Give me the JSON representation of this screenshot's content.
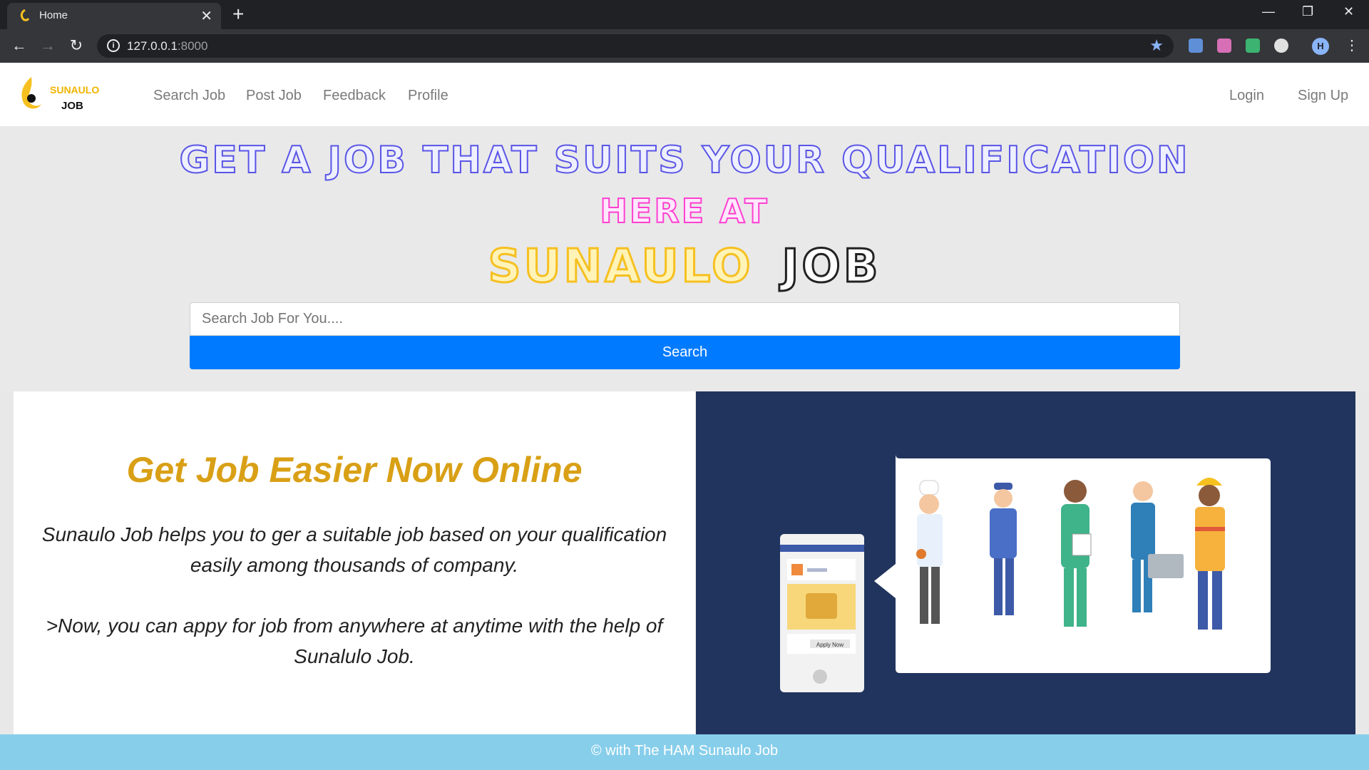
{
  "browser": {
    "tab_title": "Home",
    "tab_close": "✕",
    "new_tab": "+",
    "url_host": "127.0.0.1",
    "url_port": ":8000",
    "profile_initial": "H"
  },
  "site": {
    "logo": {
      "top": "SUNAULO",
      "bottom": "JOB"
    },
    "nav": [
      "Search Job",
      "Post Job",
      "Feedback",
      "Profile"
    ],
    "auth": {
      "login": "Login",
      "signup": "Sign Up"
    }
  },
  "hero": {
    "line1": "GET A JOB THAT SUITS YOUR QUALIFICATION",
    "line2": "HERE AT",
    "brand_a": "SUNAULO",
    "brand_b": "JOB",
    "search_placeholder": "Search Job For You....",
    "search_button": "Search"
  },
  "content": {
    "heading": "Get Job Easier Now Online",
    "p1": "Sunaulo Job helps you to ger a suitable job based on your qualification easily among thousands of company.",
    "p2": ">Now, you can appy for job from anywhere at anytime with the help of Sunalulo Job.",
    "illustration": {
      "apply_label": "Apply Now"
    }
  },
  "footer": {
    "text": "© with The HAM Sunaulo Job"
  },
  "colors": {
    "primary": "#007bff",
    "accent": "#d9a016",
    "footer": "#87ceeb",
    "panel": "#21345e"
  }
}
